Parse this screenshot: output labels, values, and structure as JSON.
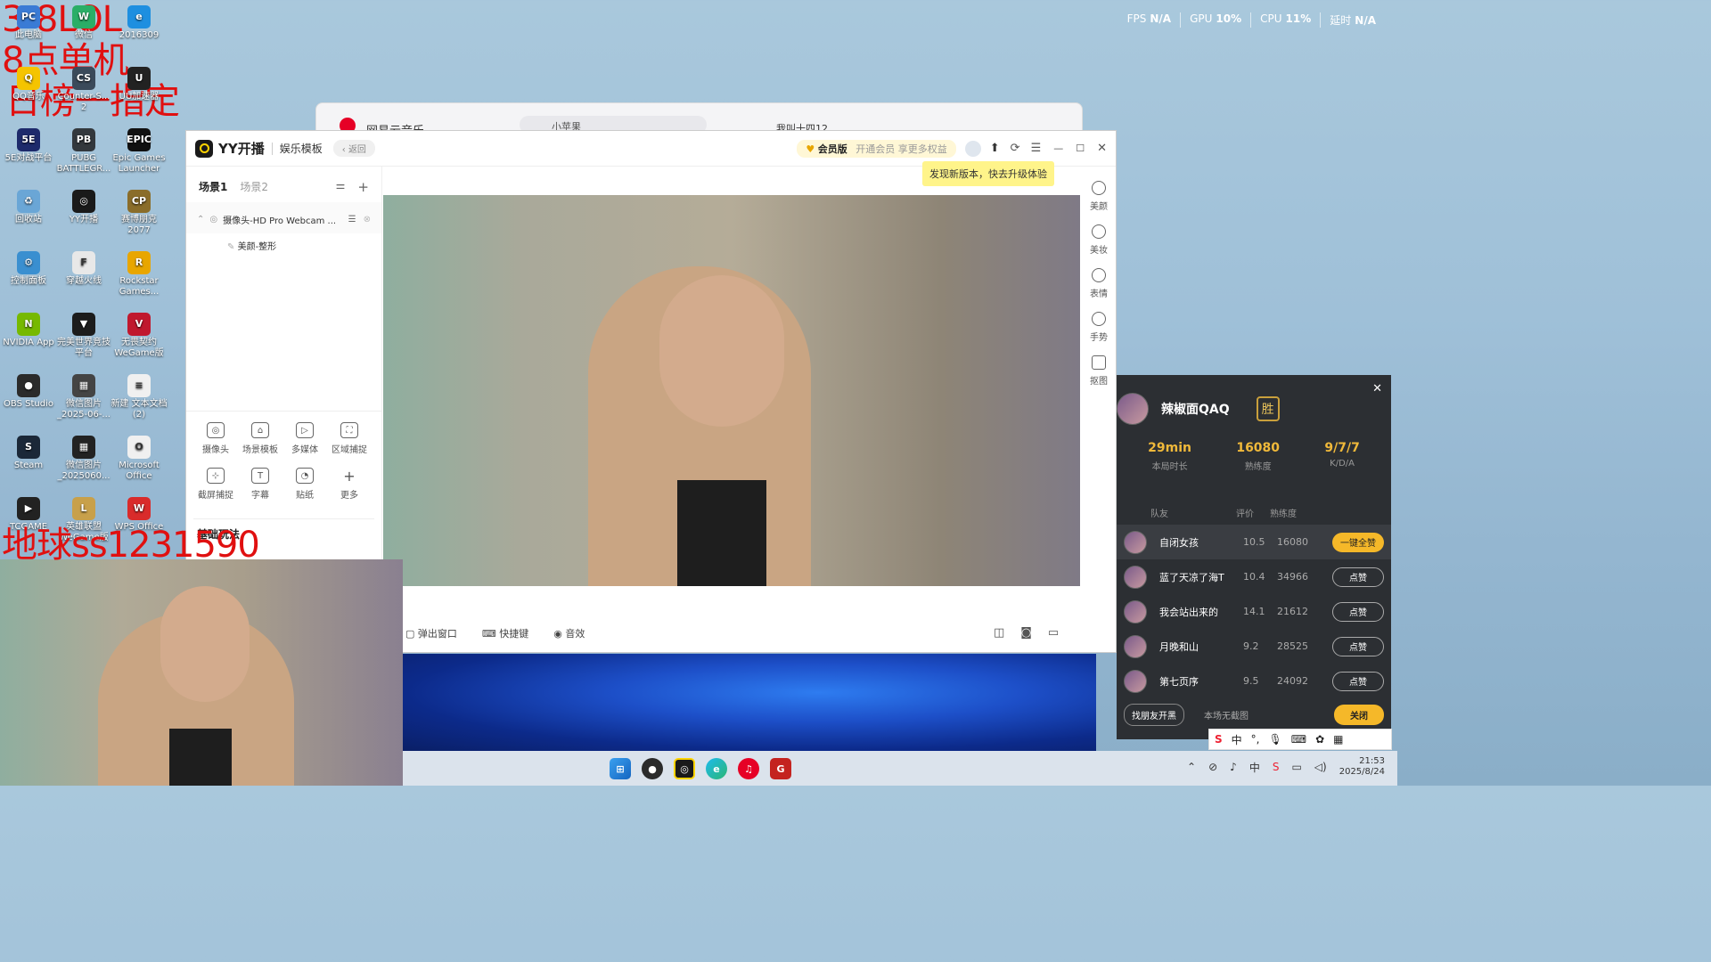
{
  "overlay": {
    "line1": "3-8LOL",
    "line2": "8点单机",
    "line3": "日榜一指定",
    "line4": "地球ss1231590"
  },
  "stats": [
    {
      "label": "FPS",
      "value": "N/A"
    },
    {
      "label": "GPU",
      "value": "10%"
    },
    {
      "label": "CPU",
      "value": "11%"
    },
    {
      "label": "延时",
      "value": "N/A"
    }
  ],
  "desktop_icons": [
    {
      "label": "此电脑",
      "color": "#3a7bd5",
      "glyph": "PC"
    },
    {
      "label": "微信",
      "color": "#2aae67",
      "glyph": "W"
    },
    {
      "label": "2016309",
      "color": "#1e8fe0",
      "glyph": "e"
    },
    {
      "label": "QQ音乐",
      "color": "#f5c400",
      "glyph": "Q"
    },
    {
      "label": "Counter-S... 2",
      "color": "#3b4a5a",
      "glyph": "CS"
    },
    {
      "label": "UU加速器",
      "color": "#222",
      "glyph": "U"
    },
    {
      "label": "5E对战平台",
      "color": "#1d2a6b",
      "glyph": "5E"
    },
    {
      "label": "PUBG BATTLEGR...",
      "color": "#33383d",
      "glyph": "PB"
    },
    {
      "label": "Epic Games Launcher",
      "color": "#111",
      "glyph": "EPIC"
    },
    {
      "label": "回收站",
      "color": "#6aa6d6",
      "glyph": "♻"
    },
    {
      "label": "YY开播",
      "color": "#1a1a1a",
      "glyph": "◎"
    },
    {
      "label": "赛博朋克 2077",
      "color": "#8a6d2a",
      "glyph": "CP"
    },
    {
      "label": "控制面板",
      "color": "#3a8fd0",
      "glyph": "⚙"
    },
    {
      "label": "穿越火线",
      "color": "#e8e8e8",
      "glyph": "F"
    },
    {
      "label": "Rockstar Games...",
      "color": "#e8a600",
      "glyph": "R"
    },
    {
      "label": "NVIDIA App",
      "color": "#76b900",
      "glyph": "N"
    },
    {
      "label": "完美世界竞技平台",
      "color": "#1c1c1c",
      "glyph": "▼"
    },
    {
      "label": "无畏契约 WeGame版",
      "color": "#c0182e",
      "glyph": "V"
    },
    {
      "label": "OBS Studio",
      "color": "#2b2b2b",
      "glyph": "●"
    },
    {
      "label": "微信图片_2025-06-...",
      "color": "#444",
      "glyph": "▦"
    },
    {
      "label": "新建 文本文档 (2)",
      "color": "#f0f0f0",
      "glyph": "≡"
    },
    {
      "label": "Steam",
      "color": "#1b2838",
      "glyph": "S"
    },
    {
      "label": "微信图片_2025060...",
      "color": "#222",
      "glyph": "▦"
    },
    {
      "label": "Microsoft Office",
      "color": "#f0f0f0",
      "glyph": "O"
    },
    {
      "label": "TCGAME",
      "color": "#222",
      "glyph": "▶"
    },
    {
      "label": "英雄联盟 WeGame版",
      "color": "#c8a04a",
      "glyph": "L"
    },
    {
      "label": "WPS Office",
      "color": "#d92b2b",
      "glyph": "W"
    }
  ],
  "music": {
    "title": "网易云音乐",
    "search": "小苹果",
    "user": "我叫十四12"
  },
  "yy": {
    "brand": "YY开播",
    "template": "娱乐模板",
    "back": "返回",
    "vip": "会员版",
    "vip_promo": "开通会员 享更多权益",
    "update_tip": "发现新版本，快去升级体验",
    "scenes": [
      "场景1",
      "场景2"
    ],
    "source": "摄像头-HD Pro Webcam ...",
    "sub_source": "美颜-整形",
    "tools_row1": [
      "摄像头",
      "场景模板",
      "多媒体",
      "区域捕捉"
    ],
    "tools_row2": [
      "截屏捕捉",
      "字幕",
      "贴纸",
      "更多"
    ],
    "section": "基础玩法",
    "right_tools": [
      "美颜",
      "美妆",
      "表情",
      "手势",
      "抠图"
    ],
    "bottom_tools": [
      "弹出窗口",
      "快捷键",
      "音效"
    ]
  },
  "game": {
    "player": "辣椒面QAQ",
    "result": "胜",
    "stats": [
      {
        "value": "29min",
        "label": "本局时长"
      },
      {
        "value": "16080",
        "label": "熟练度"
      },
      {
        "value": "9/7/7",
        "label": "K/D/A"
      }
    ],
    "headers": [
      "队友",
      "评价",
      "熟练度"
    ],
    "rows": [
      {
        "name": "自闭女孩",
        "score": "10.5",
        "mastery": "16080",
        "button": "一键全赞"
      },
      {
        "name": "蓝了天凉了海T",
        "score": "10.4",
        "mastery": "34966",
        "button": "点赞"
      },
      {
        "name": "我会站出来的",
        "score": "14.1",
        "mastery": "21612",
        "button": "点赞"
      },
      {
        "name": "月晚和山",
        "score": "9.2",
        "mastery": "28525",
        "button": "点赞"
      },
      {
        "name": "第七页序",
        "score": "9.5",
        "mastery": "24092",
        "button": "点赞"
      }
    ],
    "footer_btn": "找朋友开黑",
    "footer_text": "本场无截图",
    "close_btn": "关闭"
  },
  "tray": {
    "time": "21:53",
    "date": "2025/8/24",
    "ime": "中"
  }
}
